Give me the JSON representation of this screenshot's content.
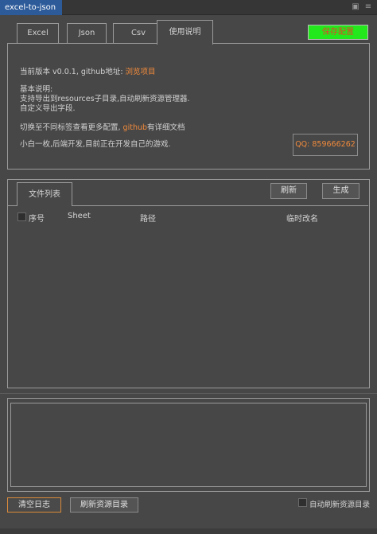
{
  "window": {
    "tab_title": "excel-to-json",
    "icons": [
      "restore-icon",
      "menu-icon"
    ]
  },
  "tabs": [
    {
      "label": "Excel",
      "active": false
    },
    {
      "label": "Json",
      "active": false
    },
    {
      "label": "Csv",
      "active": false
    },
    {
      "label": "使用说明",
      "active": true
    }
  ],
  "save_button": {
    "label": "保存配置",
    "color": "#22e81c",
    "text_color": "#e0462a"
  },
  "info": {
    "version_prefix": "当前版本 v0.0.1, github地址: ",
    "version_link": "浏览项目",
    "basic_title": "基本说明:",
    "basic_line1": "支持导出到resources子目录,自动刷新资源管理器.",
    "basic_line2": "自定义导出字段.",
    "switch_prefix": "切换至不同标签查看更多配置, ",
    "switch_link": "github",
    "switch_suffix": "有详细文档",
    "intro": "小白一枚,后端开发,目前正在开发自己的游戏.",
    "qq": "QQ: 859666262",
    "accent": "#f08a3c"
  },
  "files": {
    "tab_label": "文件列表",
    "refresh_label": "刷新",
    "generate_label": "生成",
    "columns": [
      "序号",
      "Sheet",
      "路径",
      "临时改名"
    ],
    "rows": []
  },
  "log": {
    "text": ""
  },
  "footer": {
    "clear_log": "清空日志",
    "refresh_dir": "刷新资源目录",
    "auto_refresh_label": "自动刷新资源目录",
    "auto_refresh_checked": false
  }
}
